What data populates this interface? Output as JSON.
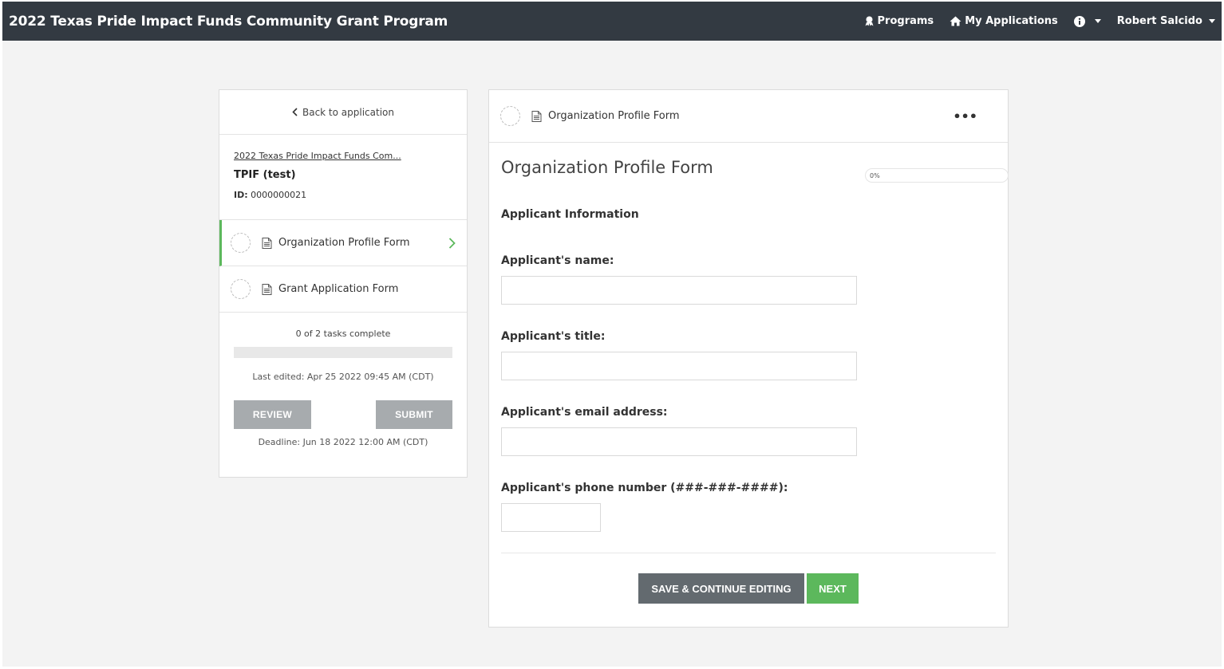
{
  "navbar": {
    "title": "2022 Texas Pride Impact Funds Community Grant Program",
    "programs": "Programs",
    "my_applications": "My Applications",
    "user": "Robert Salcido"
  },
  "sidebar": {
    "back": "Back to application",
    "program_link": "2022 Texas Pride Impact Funds Com...",
    "app_name": "TPIF (test)",
    "id_label": "ID:",
    "id_value": "0000000021",
    "tasks": [
      {
        "label": "Organization Profile Form",
        "active": true
      },
      {
        "label": "Grant Application Form",
        "active": false
      }
    ],
    "tasks_complete": "0 of 2 tasks complete",
    "progress": 0,
    "last_edited": "Last edited: Apr 25 2022 09:45 AM (CDT)",
    "review": "REVIEW",
    "submit": "SUBMIT",
    "deadline": "Deadline: Jun 18 2022 12:00 AM (CDT)"
  },
  "main": {
    "header_label": "Organization Profile Form",
    "more": "•••",
    "form_title": "Organization Profile Form",
    "percent": "0%",
    "section": "Applicant Information",
    "fields": [
      {
        "label": "Applicant's name:",
        "value": ""
      },
      {
        "label": "Applicant's title:",
        "value": ""
      },
      {
        "label": "Applicant's email address:",
        "value": ""
      },
      {
        "label": "Applicant's phone number (###-###-####):",
        "value": ""
      }
    ],
    "save": "SAVE & CONTINUE EDITING",
    "next": "NEXT"
  },
  "colors": {
    "navbar": "#333a42",
    "accent": "#5cb85c",
    "grey_button": "#a7abae",
    "dark_button": "#636a6f"
  }
}
